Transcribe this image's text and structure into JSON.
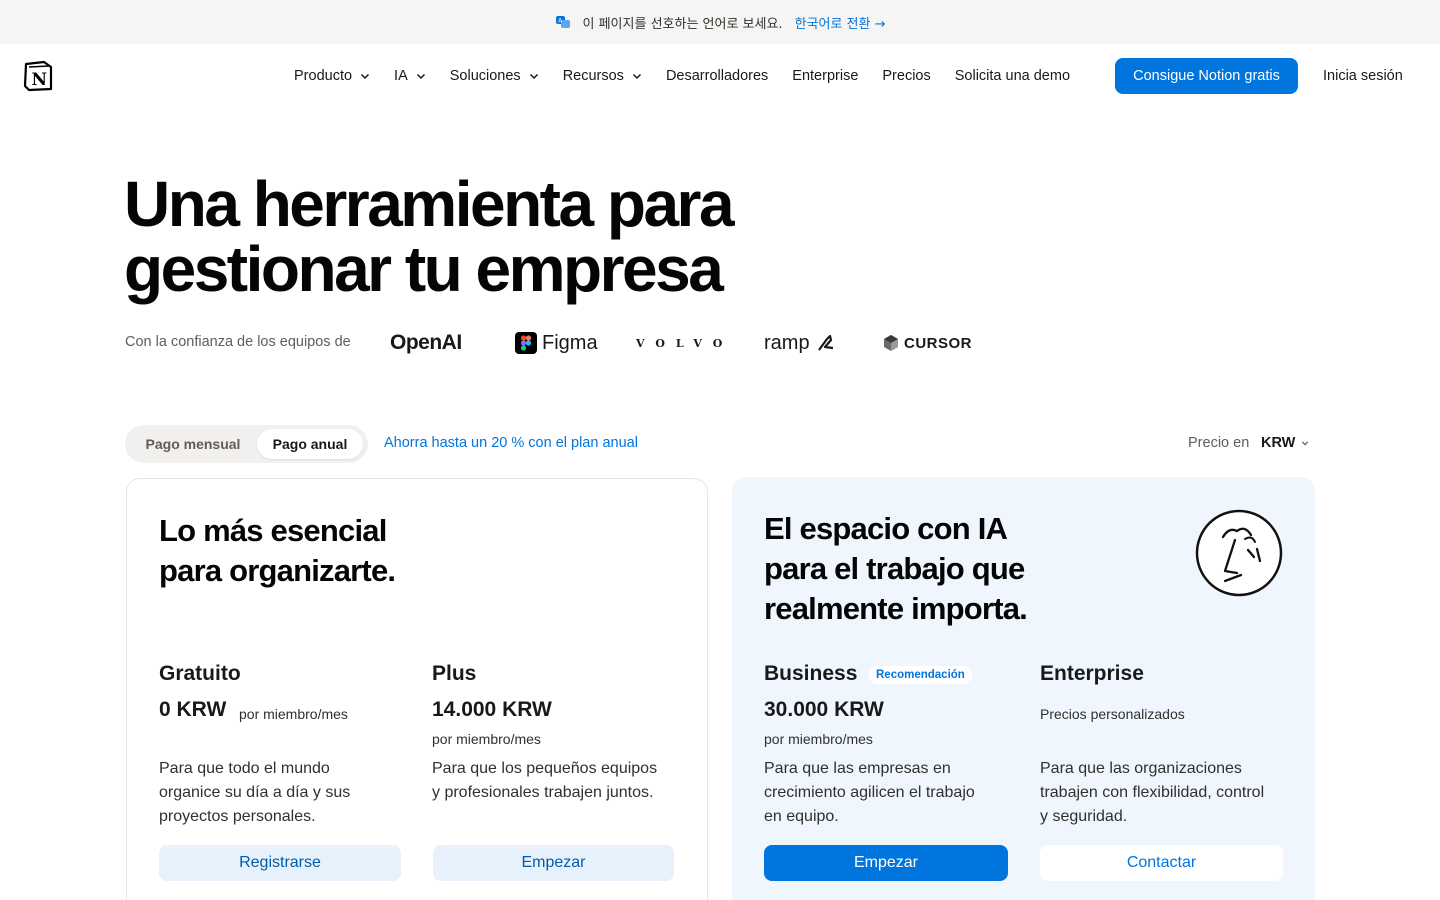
{
  "banner": {
    "message": "이 페이지를 선호하는 언어로 보세요.",
    "link": "한국어로 전환 →"
  },
  "nav": {
    "items": [
      {
        "label": "Producto",
        "has_dropdown": true
      },
      {
        "label": "IA",
        "has_dropdown": true
      },
      {
        "label": "Soluciones",
        "has_dropdown": true
      },
      {
        "label": "Recursos",
        "has_dropdown": true
      },
      {
        "label": "Desarrolladores",
        "has_dropdown": false
      },
      {
        "label": "Enterprise",
        "has_dropdown": false
      },
      {
        "label": "Precios",
        "has_dropdown": false
      },
      {
        "label": "Solicita una demo",
        "has_dropdown": false
      }
    ],
    "cta": "Consigue Notion gratis",
    "login": "Inicia sesión"
  },
  "hero": {
    "title_line1": "Una herramienta para",
    "title_line2": "gestionar tu empresa",
    "trust_label": "Con la confianza de los equipos de",
    "logos": [
      "OpenAI",
      "Figma",
      "VOLVO",
      "ramp",
      "CURSOR"
    ]
  },
  "billing": {
    "monthly": "Pago mensual",
    "annual": "Pago anual",
    "selected": "annual",
    "save_note": "Ahorra hasta un 20 % con el plan anual",
    "price_in": "Precio en",
    "currency": "KRW"
  },
  "cards": {
    "left_heading_1": "Lo más esencial",
    "left_heading_2": "para organizarte.",
    "right_heading_1": "El espacio con IA",
    "right_heading_2": "para el trabajo que",
    "right_heading_3": "realmente importa."
  },
  "plans": {
    "free": {
      "name": "Gratuito",
      "price": "0 KRW",
      "unit": "por miembro/mes",
      "desc_1": "Para que todo el mundo",
      "desc_2": "organice su día a día y sus",
      "desc_3": "proyectos personales.",
      "button": "Registrarse"
    },
    "plus": {
      "name": "Plus",
      "price": "14.000 KRW",
      "unit": "por miembro/mes",
      "desc_1": "Para que los pequeños equipos",
      "desc_2": "y profesionales trabajen juntos.",
      "button": "Empezar"
    },
    "business": {
      "name": "Business",
      "badge": "Recomendación",
      "price": "30.000 KRW",
      "unit": "por miembro/mes",
      "desc_1": "Para que las empresas en",
      "desc_2": "crecimiento agilicen el trabajo",
      "desc_3": "en equipo.",
      "button": "Empezar"
    },
    "enterprise": {
      "name": "Enterprise",
      "unit": "Precios personalizados",
      "desc_1": "Para que las organizaciones",
      "desc_2": "trabajen con flexibilidad, control",
      "desc_3": "y seguridad.",
      "button": "Contactar"
    }
  },
  "colors": {
    "accent": "#0075de",
    "banner_bg": "#f6f5f4",
    "card_highlight_bg": "#eff6fd",
    "button_light_bg": "#e7f1fc"
  },
  "icons": {
    "banner": "translate-icon",
    "logo": "notion-logo",
    "dropdown": "chevron-down-icon",
    "illustration": "face-doodle-icon"
  }
}
